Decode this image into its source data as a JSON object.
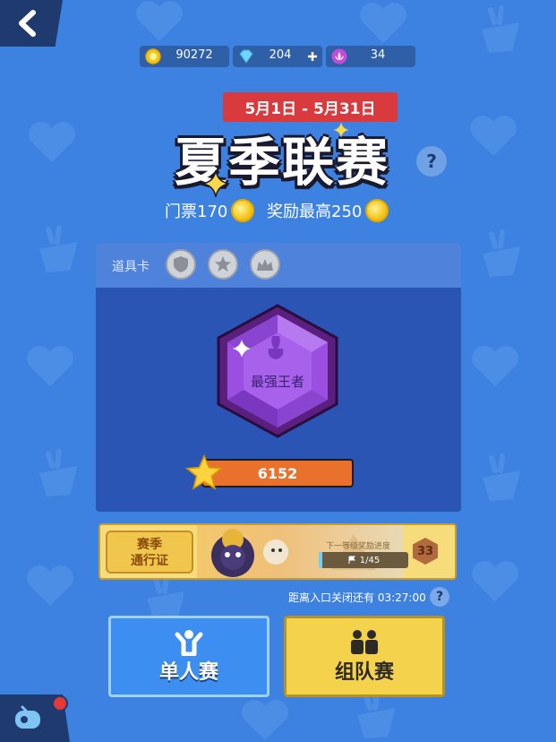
{
  "currencies": [
    {
      "icon": "gold-coin-icon",
      "value": "90272"
    },
    {
      "icon": "diamond-icon",
      "value": "204"
    },
    {
      "icon": "lotus-icon",
      "value": "34"
    }
  ],
  "event": {
    "date_range": "5月1日 - 5月31日",
    "title": "夏季联赛",
    "ticket": "门票170",
    "reward": "奖励最高250"
  },
  "props": {
    "label": "道具卡"
  },
  "rank": {
    "badge_text": "最强王者",
    "score": "6152"
  },
  "pass": {
    "title_line1": "赛季",
    "title_line2": "通行证",
    "next_label": "下一等级奖励进度",
    "progress": "1/45",
    "level": "33"
  },
  "countdown": "距离入口关闭还有 03:27:00",
  "modes": {
    "solo": "单人赛",
    "team": "组队赛"
  },
  "colors": {
    "background": "#3d82e0",
    "banner_red": "#d93a3d",
    "solo_blue": "#3c8ef0",
    "team_yellow": "#f5d24b",
    "score_orange": "#e9712b"
  }
}
